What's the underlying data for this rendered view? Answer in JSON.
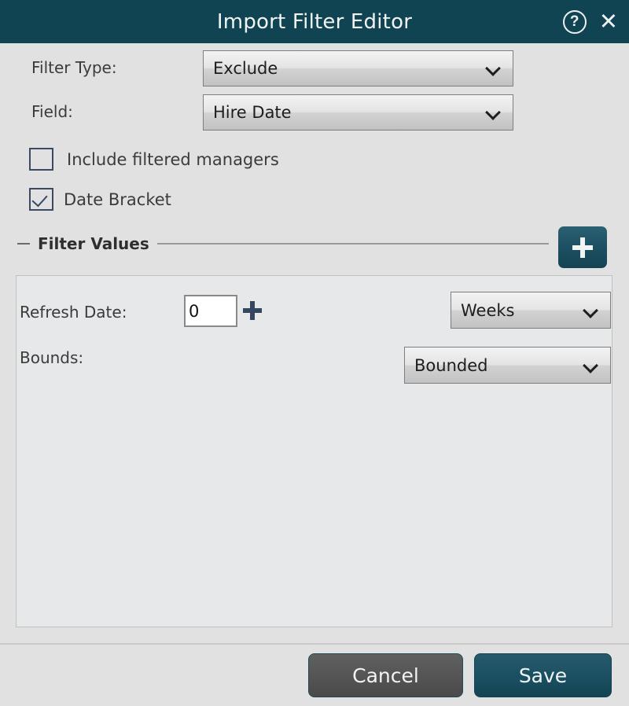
{
  "window": {
    "title": "Import Filter Editor",
    "help_icon": "help-circle-icon",
    "close_icon": "close-icon",
    "header_color": "#104453",
    "background_color": "#e1e1e1"
  },
  "form": {
    "filter_type": {
      "label": "Filter Type:",
      "value": "Exclude"
    },
    "field": {
      "label": "Field:",
      "value": "Hire Date"
    },
    "include_filtered_managers": {
      "label": "Include filtered managers",
      "checked": false
    },
    "date_bracket": {
      "label": "Date Bracket",
      "checked": true
    }
  },
  "filter_values_section": {
    "title": "Filter Values",
    "collapse_icon": "minus-icon",
    "add_icon": "plus-icon",
    "add_button_color": "#134453",
    "rows": {
      "refresh_date": {
        "label": "Refresh Date:",
        "decrement_icon": "minus-icon",
        "increment_icon": "plus-icon",
        "value": "0",
        "placeholder": "0",
        "unit": "Weeks"
      },
      "bounds": {
        "label": "Bounds:",
        "value": "Bounded"
      }
    }
  },
  "footer": {
    "cancel_label": "Cancel",
    "save_label": "Save",
    "save_color": "#134453",
    "cancel_color": "#555555"
  }
}
